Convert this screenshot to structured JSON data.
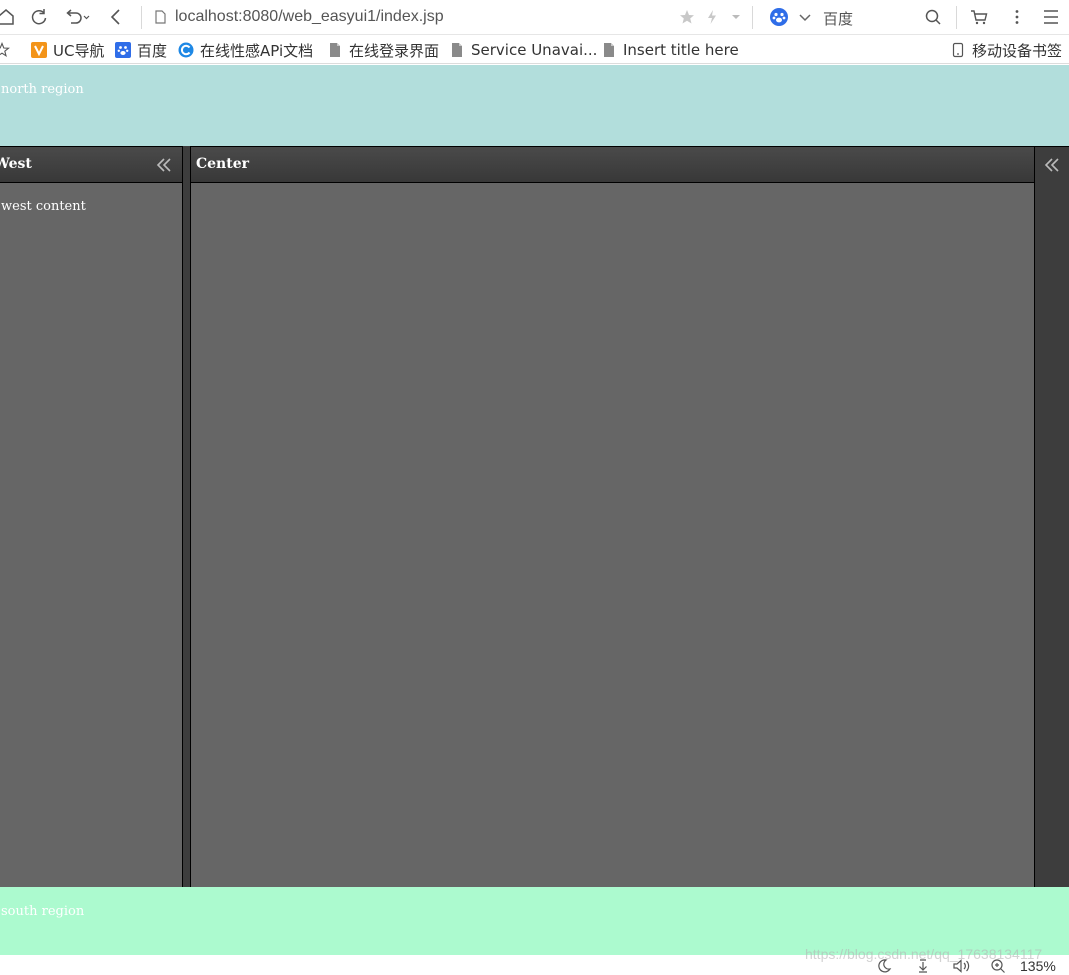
{
  "browser": {
    "url": "localhost:8080/web_easyui1/index.jsp",
    "search_engine": "百度",
    "zoom": "135%"
  },
  "bookmarks": [
    {
      "label": "UC导航",
      "icon": "uc-nav-icon"
    },
    {
      "label": "百度",
      "icon": "baidu-icon"
    },
    {
      "label": "在线性感APi文档",
      "icon": "c-logo-icon"
    },
    {
      "label": "在线登录界面",
      "icon": "page-icon"
    },
    {
      "label": "Service Unavai...",
      "icon": "page-icon"
    },
    {
      "label": "Insert title here",
      "icon": "page-icon"
    }
  ],
  "mobile_bookmarks": "移动设备书签",
  "layout": {
    "north": "north region",
    "west_title": "West",
    "west_content": "west content",
    "center_title": "Center",
    "south": "south region"
  },
  "watermark": "https://blog.csdn.net/qq_17638134117",
  "colors": {
    "north_bg": "#b2dedc",
    "south_bg": "#acfacf",
    "panel_bg": "#666666",
    "header_bg": "#3d3d3d"
  }
}
